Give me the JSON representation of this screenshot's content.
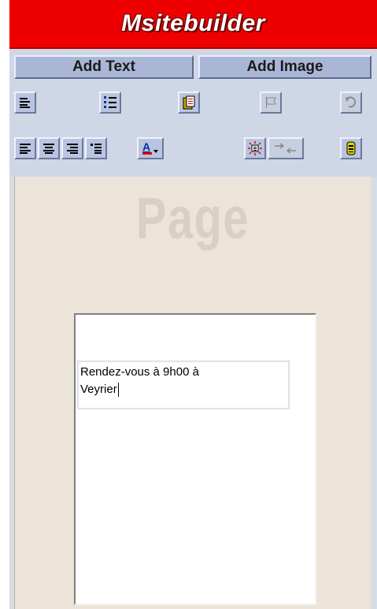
{
  "app": {
    "title": "Msitebuilder"
  },
  "buttons": {
    "add_text": "Add Text",
    "add_image": "Add Image"
  },
  "toolbar": {
    "row1": [
      {
        "name": "bulleted-text-icon",
        "disabled": false
      },
      {
        "name": "numbered-list-icon",
        "disabled": false
      },
      {
        "name": "paste-icon",
        "disabled": false
      },
      {
        "name": "flag-icon",
        "disabled": true
      },
      {
        "name": "undo-icon",
        "disabled": true
      }
    ],
    "row2": [
      {
        "name": "align-left-icon",
        "disabled": false
      },
      {
        "name": "align-center-icon",
        "disabled": false
      },
      {
        "name": "align-right-icon",
        "disabled": false
      },
      {
        "name": "indent-icon",
        "disabled": false
      },
      {
        "name": "font-color-icon",
        "disabled": false
      },
      {
        "name": "highlight-icon",
        "disabled": false
      },
      {
        "name": "swap-icon",
        "disabled": true
      },
      {
        "name": "settings-icon",
        "disabled": false
      }
    ]
  },
  "canvas": {
    "watermark": "Page",
    "textbox": {
      "line1": "Rendez-vous à 9h00 à",
      "line2": "Veyrier"
    }
  },
  "colors": {
    "titlebar": "#ee0000",
    "toolbar": "#cfd6e6",
    "canvas": "#ece4d8"
  }
}
